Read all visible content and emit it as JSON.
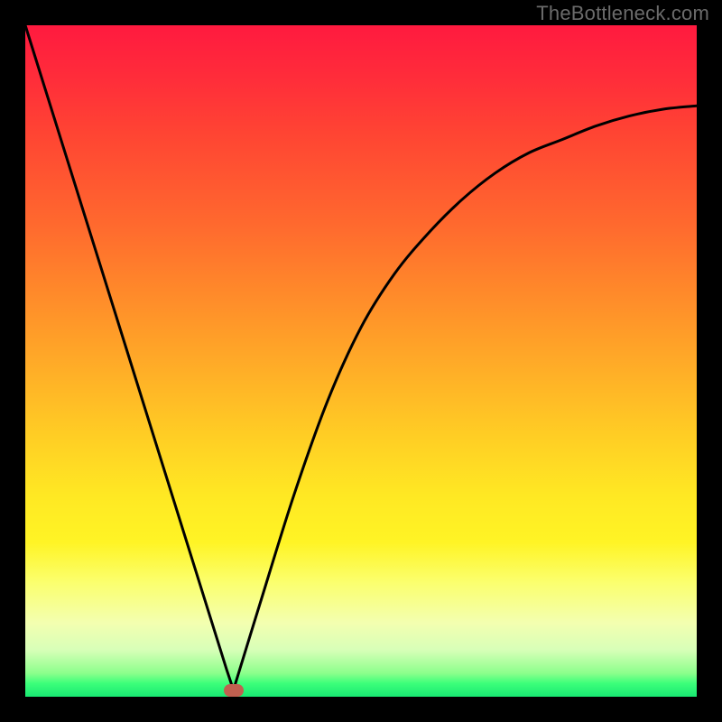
{
  "watermark": "TheBottleneck.com",
  "colors": {
    "frame": "#000000",
    "curve": "#000000",
    "marker": "#c06050"
  },
  "chart_data": {
    "type": "line",
    "title": "",
    "xlabel": "",
    "ylabel": "",
    "xlim": [
      0,
      100
    ],
    "ylim": [
      0,
      100
    ],
    "grid": false,
    "legend": false,
    "annotations": [
      {
        "type": "min-marker",
        "x": 31,
        "y": 1
      }
    ],
    "series": [
      {
        "name": "bottleneck-curve",
        "x": [
          0,
          5,
          10,
          15,
          20,
          25,
          30,
          31,
          35,
          40,
          45,
          50,
          55,
          60,
          65,
          70,
          75,
          80,
          85,
          90,
          95,
          100
        ],
        "y": [
          100,
          84,
          68,
          52,
          36,
          20,
          4,
          1,
          14,
          30,
          44,
          55,
          63,
          69,
          74,
          78,
          81,
          83,
          85,
          86.5,
          87.5,
          88
        ]
      }
    ]
  }
}
